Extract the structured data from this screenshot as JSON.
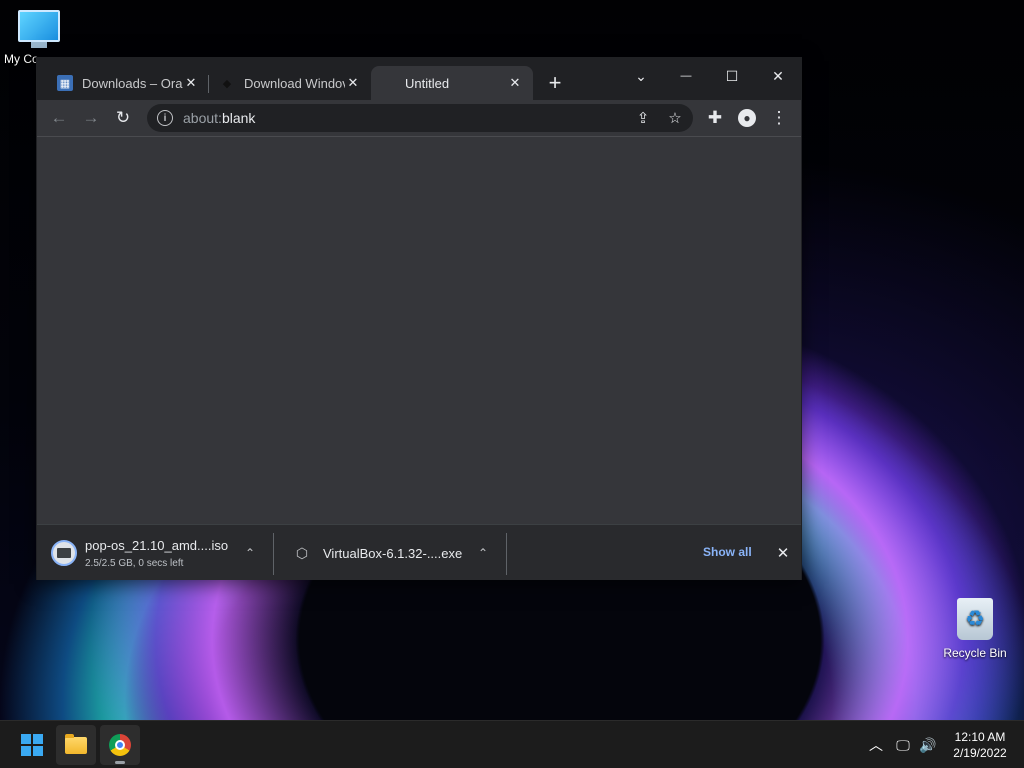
{
  "desktop": {
    "icons": [
      {
        "label": "My Co"
      },
      {
        "label": "Recycle Bin"
      }
    ]
  },
  "browser": {
    "tabs": [
      {
        "title": "Downloads – Orac",
        "favicon": "oracle-downloads-icon"
      },
      {
        "title": "Download Windov",
        "favicon": "pin-icon"
      },
      {
        "title": "Untitled",
        "favicon": "",
        "active": true
      }
    ],
    "window_controls": {
      "search_tabs": "⌄",
      "minimize": "—",
      "maximize": "☐",
      "close": "✕"
    },
    "toolbar": {
      "url_scheme": "about:",
      "url_rest": "blank"
    },
    "downloads": [
      {
        "name": "pop-os_21.10_amd....iso",
        "status": "2.5/2.5 GB, 0 secs left",
        "icon": "disc-image-icon"
      },
      {
        "name": "VirtualBox-6.1.32-....exe",
        "status": "",
        "icon": "package-icon"
      }
    ],
    "show_all_label": "Show all"
  },
  "taskbar": {
    "clock_time": "12:10 AM",
    "clock_date": "2/19/2022"
  },
  "colors": {
    "accent_link": "#8ab4f8",
    "tab_strip": "#202124",
    "toolbar": "#35363a",
    "download_bar": "#292a2d"
  }
}
